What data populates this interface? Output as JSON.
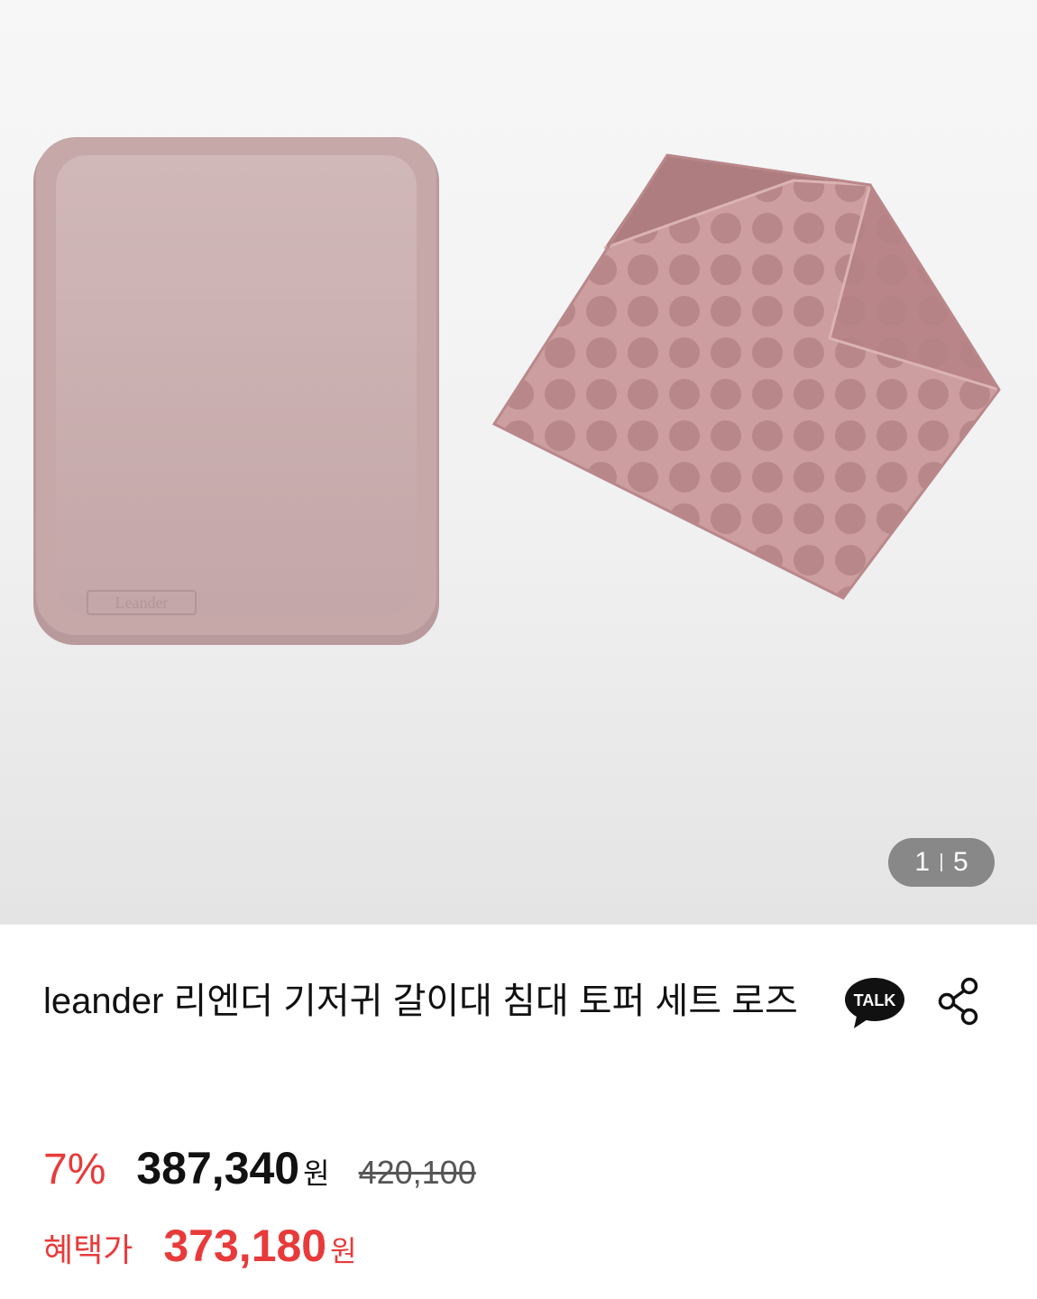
{
  "gallery": {
    "current": "1",
    "total": "5",
    "pad_logo": "Leander"
  },
  "product": {
    "title": "leander 리엔더 기저귀 갈이대 침대 토퍼 세트 로즈",
    "talk_label": "TALK"
  },
  "price": {
    "discount": "7%",
    "sale_price": "387,340",
    "currency": "원",
    "original_price": "420,100",
    "benefit_label": "혜택가",
    "benefit_price": "373,180"
  },
  "colors": {
    "accent_red": "#e83a3a",
    "product_rose": "#c99a9c"
  }
}
